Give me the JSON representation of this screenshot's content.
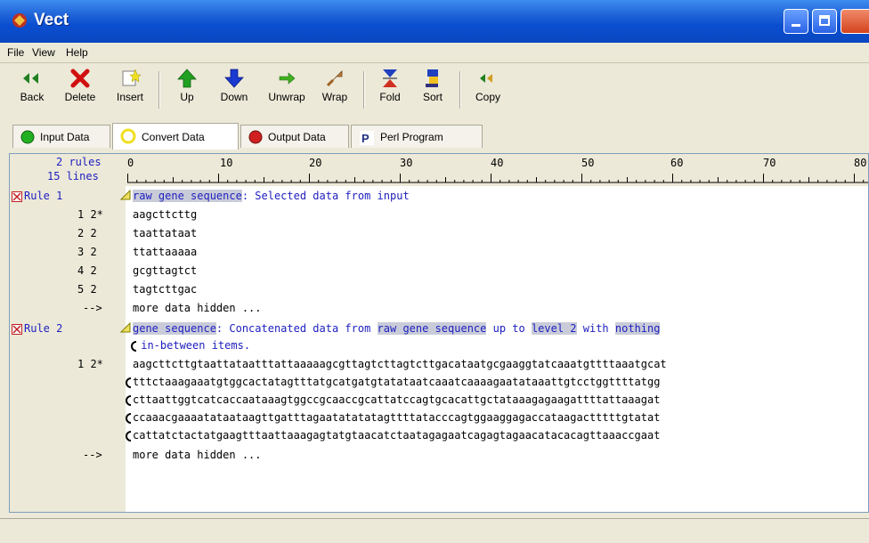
{
  "window": {
    "title": "Vect"
  },
  "menu": [
    "File",
    "View",
    "Help"
  ],
  "toolbar": [
    {
      "label": "Back",
      "icon": "back-arrows-icon"
    },
    {
      "label": "Delete",
      "icon": "red-x-icon"
    },
    {
      "label": "Insert",
      "icon": "insert-star-icon"
    },
    {
      "label": "Up",
      "icon": "green-up-arrow-icon"
    },
    {
      "label": "Down",
      "icon": "blue-down-arrow-icon"
    },
    {
      "label": "Unwrap",
      "icon": "unwrap-icon"
    },
    {
      "label": "Wrap",
      "icon": "wrap-icon"
    },
    {
      "label": "Fold",
      "icon": "fold-icon"
    },
    {
      "label": "Sort",
      "icon": "sort-icon"
    },
    {
      "label": "Copy",
      "icon": "copy-icon"
    }
  ],
  "tabs": [
    {
      "label": "Input Data",
      "color": "#22b022"
    },
    {
      "label": "Convert Data",
      "color": "#f0e020"
    },
    {
      "label": "Output Data",
      "color": "#d02020"
    },
    {
      "label": "Perl Program",
      "color": "#203080"
    }
  ],
  "editor": {
    "rules_count": "2 rules",
    "lines_count": "15 lines",
    "ruler_numbers": [
      "0",
      "10",
      "20",
      "30",
      "40",
      "50",
      "60",
      "70",
      "80"
    ],
    "rule1": {
      "label": "Rule 1",
      "name": "raw gene sequence",
      "desc": ": Selected data from input",
      "rows": [
        {
          "num": "1 2*",
          "seq": "aagcttcttg"
        },
        {
          "num": "2 2",
          "seq": "taattataat"
        },
        {
          "num": "3 2",
          "seq": "ttattaaaaa"
        },
        {
          "num": "4 2",
          "seq": "gcgttagtct"
        },
        {
          "num": "5 2",
          "seq": "tagtcttgac"
        }
      ],
      "more_arrow": "-->",
      "more": "more data hidden ..."
    },
    "rule2": {
      "label": "Rule 2",
      "name": "gene sequence",
      "desc1": ": Concatenated data from ",
      "ref": "raw gene sequence",
      "desc2": " up to ",
      "level": "level 2",
      "desc3": " with ",
      "nothing": "nothing",
      "desc4": " in-between items.",
      "row_num": "1 2*",
      "seq_lines": [
        "aagcttcttgtaattataatttattaaaaagcgttagtcttagtcttgacataatgcgaaggtatcaaatgttttaaatgcat",
        "tttctaaagaaatgtggcactatagtttatgcatgatgtatataatcaaatcaaaagaatataaattgtcctggttttatgg",
        "cttaattggtcatcaccaataaagtggccgcaaccgcattatccagtgcacattgctataaagagaagattttattaaagat",
        "ccaaacgaaaatataataagttgatttagaatatatatagttttatacccagtggaaggagaccataagactttttgtatat",
        "cattatctactatgaagtttaattaaagagtatgtaacatctaatagagaatcagagtagaacatacacagttaaaccgaat"
      ],
      "more_arrow": "-->",
      "more": "more data hidden ..."
    }
  }
}
